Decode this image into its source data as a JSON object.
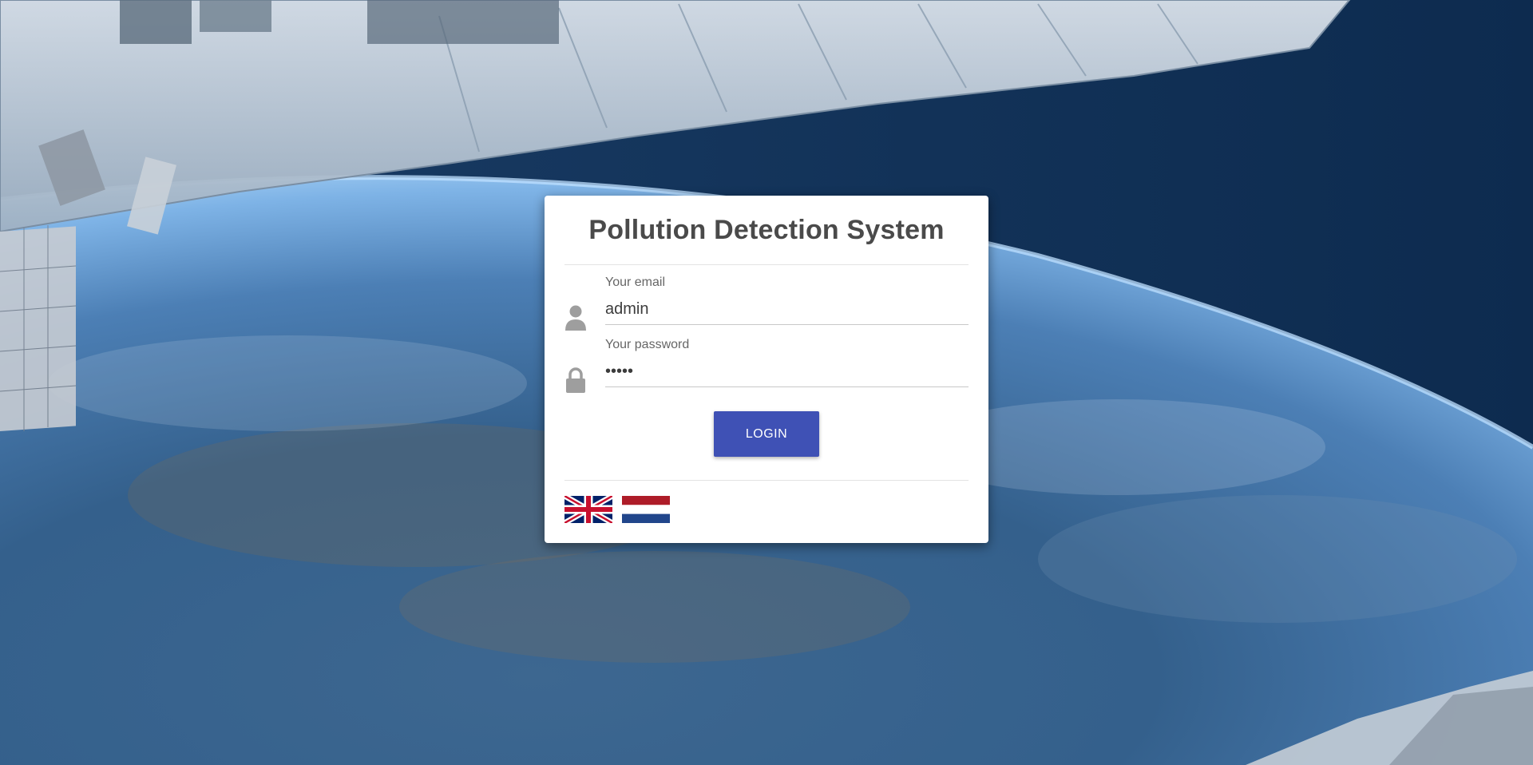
{
  "app": {
    "title": "Pollution Detection System"
  },
  "form": {
    "email": {
      "label": "Your email",
      "value": "admin",
      "icon": "user-icon"
    },
    "password": {
      "label": "Your password",
      "value": "admin",
      "icon": "lock-icon"
    },
    "login_label": "LOGIN"
  },
  "languages": [
    {
      "name": "English",
      "icon": "uk-flag-icon"
    },
    {
      "name": "Dutch",
      "icon": "netherlands-flag-icon"
    }
  ],
  "colors": {
    "accent": "#3f51b5",
    "title_text": "#4a4a4a",
    "icon_gray": "#9e9e9e"
  }
}
